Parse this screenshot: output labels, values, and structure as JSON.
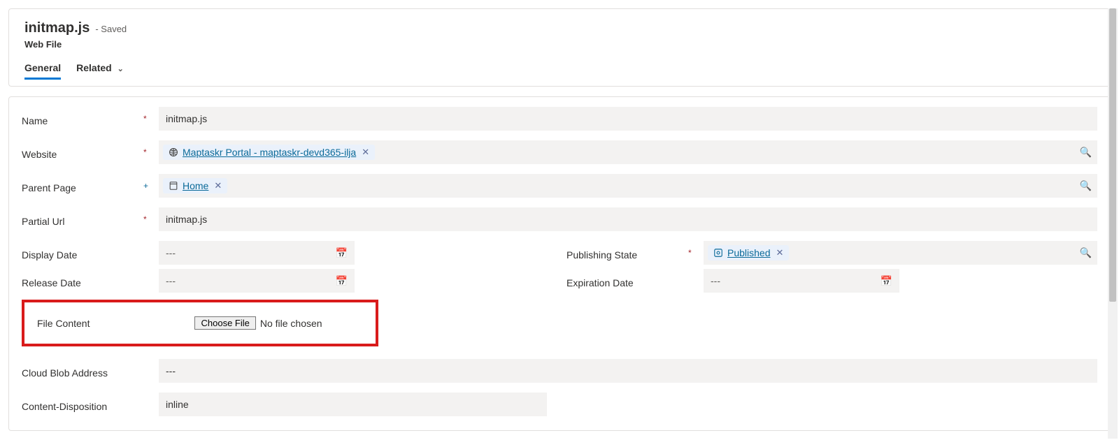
{
  "header": {
    "title": "initmap.js",
    "saved_suffix": "- Saved",
    "entity_type": "Web File"
  },
  "tabs": {
    "general": "General",
    "related": "Related"
  },
  "labels": {
    "name": "Name",
    "website": "Website",
    "parent_page": "Parent Page",
    "partial_url": "Partial Url",
    "display_date": "Display Date",
    "release_date": "Release Date",
    "publishing_state": "Publishing State",
    "expiration_date": "Expiration Date",
    "file_content": "File Content",
    "cloud_blob_address": "Cloud Blob Address",
    "content_disposition": "Content-Disposition"
  },
  "values": {
    "name": "initmap.js",
    "website_link": "Maptaskr Portal - maptaskr-devd365-ilja",
    "parent_page_link": "Home",
    "partial_url": "initmap.js",
    "display_date": "---",
    "release_date": "---",
    "publishing_state_link": "Published",
    "expiration_date": "---",
    "choose_file_button": "Choose File",
    "no_file_chosen": "No file chosen",
    "cloud_blob_address": "---",
    "content_disposition": "inline"
  },
  "marks": {
    "required": "*",
    "recommended": "+"
  }
}
